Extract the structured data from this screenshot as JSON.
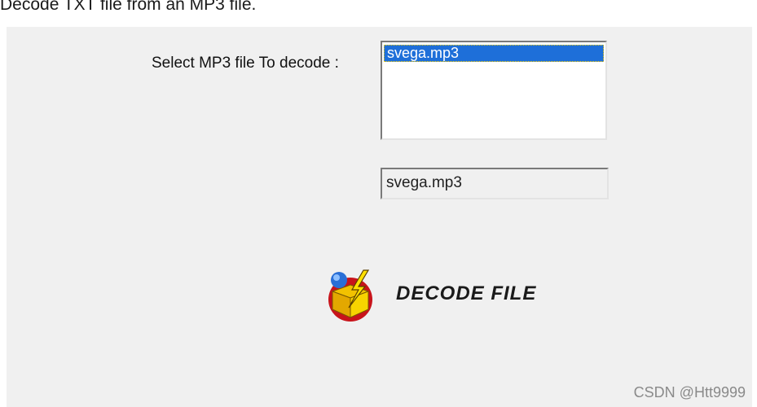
{
  "page": {
    "title": "Decode TXT file from an MP3 file."
  },
  "form": {
    "select_label": "Select MP3 file To decode :",
    "file_list": [
      "svega.mp3"
    ],
    "selected_file": "svega.mp3"
  },
  "actions": {
    "decode_label": "DECODE FILE",
    "decode_icon": "lightning-box-icon"
  },
  "watermark": {
    "text": "CSDN @Htt9999"
  },
  "colors": {
    "selection": "#1e6fd9",
    "dialog_background": "#f0f0f0"
  }
}
